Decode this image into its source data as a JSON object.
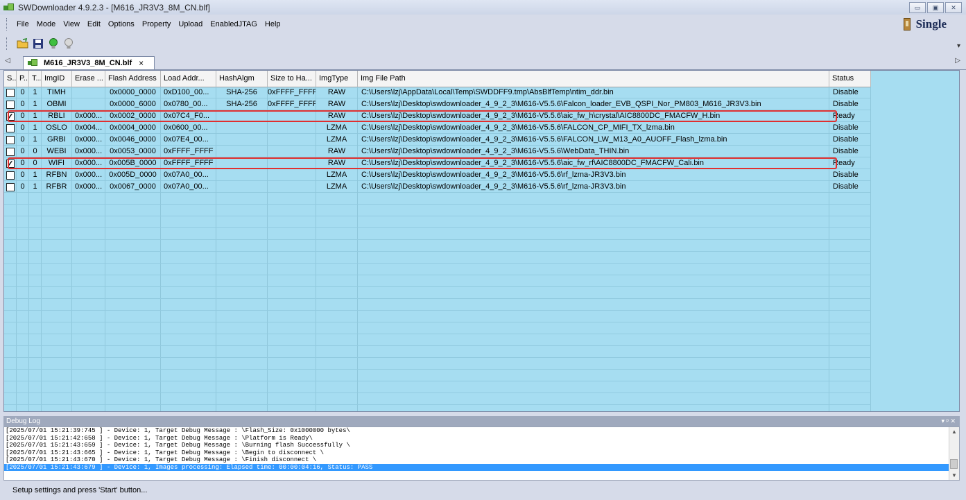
{
  "window": {
    "title": "SWDownloader 4.9.2.3 - [M616_JR3V3_8M_CN.blf]",
    "controls": [
      "▭",
      "▣",
      "✕"
    ]
  },
  "menu": {
    "items": [
      "File",
      "Mode",
      "View",
      "Edit",
      "Options",
      "Property",
      "Upload",
      "EnabledJTAG",
      "Help"
    ],
    "mode_label": "Single"
  },
  "toolbar": {
    "icons": [
      "open-folder-icon",
      "save-icon",
      "green-bulb-icon",
      "gray-bulb-icon"
    ]
  },
  "tab": {
    "label": "M616_JR3V3_8M_CN.blf",
    "close": "×"
  },
  "table": {
    "columns": [
      "S...",
      "P...",
      "T...",
      "ImgID",
      "Erase ...",
      "Flash Address",
      "Load Addr...",
      "HashAlgm",
      "Size to Ha...",
      "ImgType",
      "Img File Path",
      "Status"
    ],
    "rows": [
      {
        "checked": false,
        "p": "0",
        "t": "1",
        "id": "TIMH",
        "erase": "",
        "flash": "0x0000_0000",
        "load": "0xD100_00...",
        "hash": "SHA-256",
        "size": "0xFFFF_FFFF",
        "type": "RAW",
        "path": "C:\\Users\\lzj\\AppData\\Local\\Temp\\SWDDFF9.tmp\\AbsBlfTemp\\ntim_ddr.bin",
        "status": "Disable"
      },
      {
        "checked": false,
        "p": "0",
        "t": "1",
        "id": "OBMI",
        "erase": "",
        "flash": "0x0000_6000",
        "load": "0x0780_00...",
        "hash": "SHA-256",
        "size": "0xFFFF_FFFF",
        "type": "RAW",
        "path": "C:\\Users\\lzj\\Desktop\\swdownloader_4_9_2_3\\M616-V5.5.6\\Falcon_loader_EVB_QSPI_Nor_PM803_M616_JR3V3.bin",
        "status": "Disable"
      },
      {
        "checked": true,
        "p": "0",
        "t": "1",
        "id": "RBLI",
        "erase": "0x000...",
        "flash": "0x0002_0000",
        "load": "0x07C4_F0...",
        "hash": "",
        "size": "",
        "type": "RAW",
        "path": "C:\\Users\\lzj\\Desktop\\swdownloader_4_9_2_3\\M616-V5.5.6\\aic_fw_h\\crystal\\AIC8800DC_FMACFW_H.bin",
        "status": "Ready"
      },
      {
        "checked": false,
        "p": "0",
        "t": "1",
        "id": "OSLO",
        "erase": "0x004...",
        "flash": "0x0004_0000",
        "load": "0x0600_00...",
        "hash": "",
        "size": "",
        "type": "LZMA",
        "path": "C:\\Users\\lzj\\Desktop\\swdownloader_4_9_2_3\\M616-V5.5.6\\FALCON_CP_MIFI_TX_lzma.bin",
        "status": "Disable"
      },
      {
        "checked": false,
        "p": "0",
        "t": "1",
        "id": "GRBI",
        "erase": "0x000...",
        "flash": "0x0046_0000",
        "load": "0x07E4_00...",
        "hash": "",
        "size": "",
        "type": "LZMA",
        "path": "C:\\Users\\lzj\\Desktop\\swdownloader_4_9_2_3\\M616-V5.5.6\\FALCON_LW_M13_A0_AUOFF_Flash_lzma.bin",
        "status": "Disable"
      },
      {
        "checked": false,
        "p": "0",
        "t": "0",
        "id": "WEBI",
        "erase": "0x000...",
        "flash": "0x0053_0000",
        "load": "0xFFFF_FFFF",
        "hash": "",
        "size": "",
        "type": "RAW",
        "path": "C:\\Users\\lzj\\Desktop\\swdownloader_4_9_2_3\\M616-V5.5.6\\WebData_THIN.bin",
        "status": "Disable"
      },
      {
        "checked": true,
        "p": "0",
        "t": "0",
        "id": "WIFI",
        "erase": "0x000...",
        "flash": "0x005B_0000",
        "load": "0xFFFF_FFFF",
        "hash": "",
        "size": "",
        "type": "RAW",
        "path": "C:\\Users\\lzj\\Desktop\\swdownloader_4_9_2_3\\M616-V5.5.6\\aic_fw_rf\\AIC8800DC_FMACFW_Cali.bin",
        "status": "Ready"
      },
      {
        "checked": false,
        "p": "0",
        "t": "1",
        "id": "RFBN",
        "erase": "0x000...",
        "flash": "0x005D_0000",
        "load": "0x07A0_00...",
        "hash": "",
        "size": "",
        "type": "LZMA",
        "path": "C:\\Users\\lzj\\Desktop\\swdownloader_4_9_2_3\\M616-V5.5.6\\rf_lzma-JR3V3.bin",
        "status": "Disable"
      },
      {
        "checked": false,
        "p": "0",
        "t": "1",
        "id": "RFBR",
        "erase": "0x000...",
        "flash": "0x0067_0000",
        "load": "0x07A0_00...",
        "hash": "",
        "size": "",
        "type": "LZMA",
        "path": "C:\\Users\\lzj\\Desktop\\swdownloader_4_9_2_3\\M616-V5.5.6\\rf_lzma-JR3V3.bin",
        "status": "Disable"
      }
    ]
  },
  "debug": {
    "title": "Debug Log",
    "controls": "▾ ᵖ ✕",
    "lines": [
      "[2025/07/01 15:21:39:745 ] - Device: 1, Target Debug Message : \\Flash_Size: 0x1000000 bytes\\",
      "[2025/07/01 15:21:42:658 ] - Device: 1, Target Debug Message : \\Platform is Ready\\",
      "[2025/07/01 15:21:43:659 ] - Device: 1, Target Debug Message : \\Burning flash Successfully \\",
      "[2025/07/01 15:21:43:665 ] - Device: 1, Target Debug Message : \\Begin to disconnect \\",
      "[2025/07/01 15:21:43:670 ] - Device: 1, Target Debug Message : \\Finish disconnect \\",
      "[2025/07/01 15:21:43:679 ] - Device: 1, Images processing: Elapsed time: 00:00:04:16, Status: PASS"
    ],
    "selected_index": 5
  },
  "statusbar": {
    "text": "Setup settings and press 'Start' button..."
  }
}
